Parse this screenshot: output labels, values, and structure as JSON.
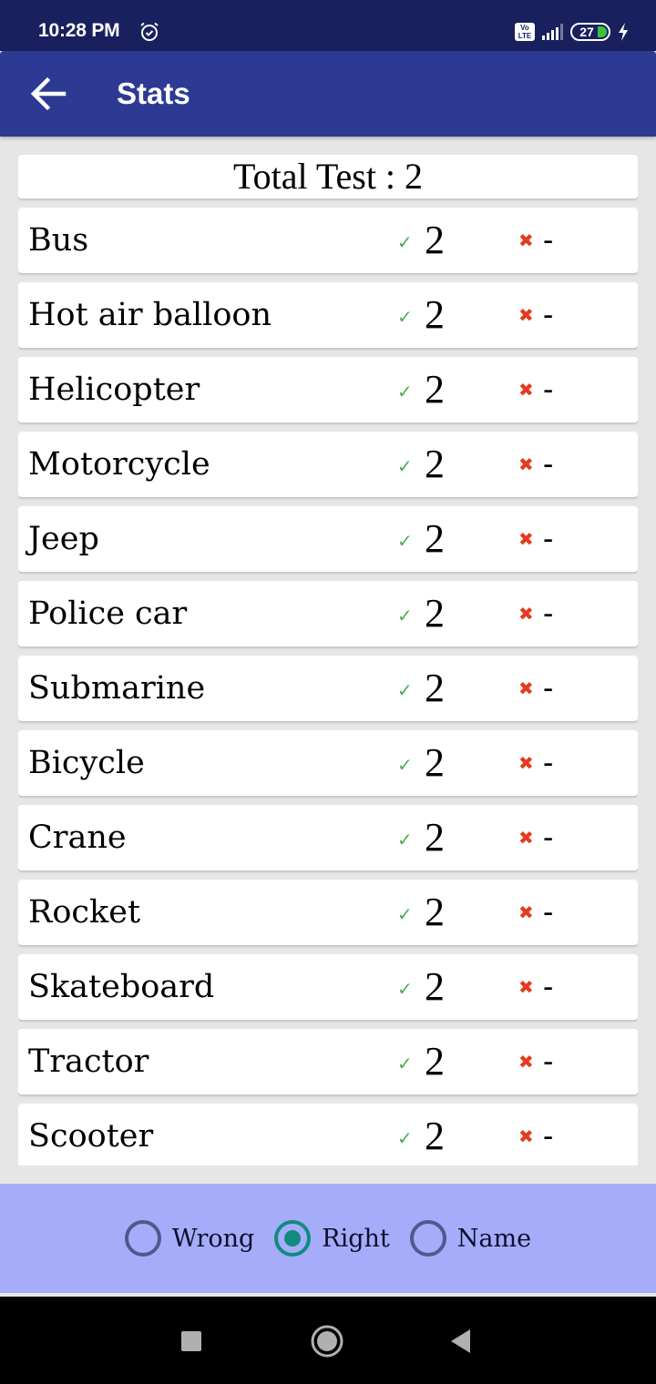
{
  "status_bar": {
    "time": "10:28 PM",
    "network_badge": "Vo LTE",
    "battery_level": "27",
    "icons": [
      "alarm-icon",
      "volte-icon",
      "signal-icon",
      "battery-icon",
      "charging-icon"
    ]
  },
  "app_bar": {
    "title": "Stats",
    "back_icon": "arrow-left-icon"
  },
  "summary": {
    "label": "Total Test : 2"
  },
  "colors": {
    "status_bar": "#19205e",
    "app_bar": "#2d3a93",
    "right_mark": "#4caf50",
    "wrong_mark": "#e53a1e",
    "filter_bar": "#a5adfb",
    "radio_selected": "#128a80"
  },
  "items": [
    {
      "name": "Bus",
      "right": "2",
      "wrong": "-"
    },
    {
      "name": "Hot air balloon",
      "right": "2",
      "wrong": "-"
    },
    {
      "name": "Helicopter",
      "right": "2",
      "wrong": "-"
    },
    {
      "name": "Motorcycle",
      "right": "2",
      "wrong": "-"
    },
    {
      "name": "Jeep",
      "right": "2",
      "wrong": "-"
    },
    {
      "name": "Police car",
      "right": "2",
      "wrong": "-"
    },
    {
      "name": "Submarine",
      "right": "2",
      "wrong": "-"
    },
    {
      "name": "Bicycle",
      "right": "2",
      "wrong": "-"
    },
    {
      "name": "Crane",
      "right": "2",
      "wrong": "-"
    },
    {
      "name": "Rocket",
      "right": "2",
      "wrong": "-"
    },
    {
      "name": "Skateboard",
      "right": "2",
      "wrong": "-"
    },
    {
      "name": "Tractor",
      "right": "2",
      "wrong": "-"
    },
    {
      "name": "Scooter",
      "right": "2",
      "wrong": "-"
    }
  ],
  "marks": {
    "right_glyph": "✓",
    "wrong_glyph": "✖"
  },
  "sort_options": [
    {
      "label": "Wrong",
      "selected": false
    },
    {
      "label": "Right",
      "selected": true
    },
    {
      "label": "Name",
      "selected": false
    }
  ],
  "nav_bar": {
    "buttons": [
      "recents-button",
      "home-button",
      "back-button"
    ]
  }
}
